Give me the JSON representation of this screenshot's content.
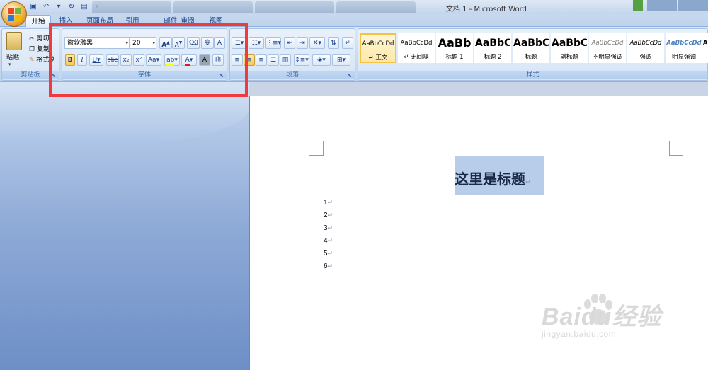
{
  "window": {
    "title": "文档 1 - Microsoft Word"
  },
  "tabs": [
    "开始",
    "插入",
    "页面布局",
    "引用",
    "邮件",
    "审阅",
    "视图"
  ],
  "clipboard": {
    "paste": "粘贴",
    "cut": "剪切",
    "copy": "复制",
    "format_painter": "格式刷",
    "label": "剪贴板"
  },
  "font": {
    "name": "微软雅黑",
    "size": "20",
    "label": "字体",
    "buttons": {
      "bold": "B",
      "italic": "I",
      "underline": "U",
      "strike": "abc",
      "sub": "x₂",
      "sup": "x²",
      "case": "Aa",
      "font_color": "A",
      "shade": "A",
      "enclose": "字",
      "grow": "A",
      "shrink": "A",
      "phonetic": "变",
      "border": "A"
    }
  },
  "paragraph": {
    "label": "段落"
  },
  "styles": {
    "label": "样式",
    "items": [
      {
        "sample": "AaBbCcDd",
        "name": "正文",
        "selected": true
      },
      {
        "sample": "AaBbCcDd",
        "name": "无间隔"
      },
      {
        "sample": "AaBb",
        "name": "标题 1"
      },
      {
        "sample": "AaBbC",
        "name": "标题 2"
      },
      {
        "sample": "AaBbC",
        "name": "标题"
      },
      {
        "sample": "AaBbC",
        "name": "副标题"
      },
      {
        "sample": "AaBbCcDd",
        "name": "不明显强调"
      },
      {
        "sample": "AaBbCcDd",
        "name": "强调"
      },
      {
        "sample": "AaBbCcDd",
        "name": "明显强调"
      },
      {
        "sample": "Aa",
        "name": ""
      }
    ]
  },
  "document": {
    "title": "这里是标题",
    "mark": "↵",
    "lines": [
      "1",
      "2",
      "3",
      "4",
      "5",
      "6"
    ]
  },
  "watermark": {
    "brand": "Baidu经验",
    "url": "jingyan.baidu.com"
  },
  "colors": {
    "highlight_box": "#ef3b3b",
    "selection": "#b8cde9",
    "style_selected": "#f5c242"
  }
}
